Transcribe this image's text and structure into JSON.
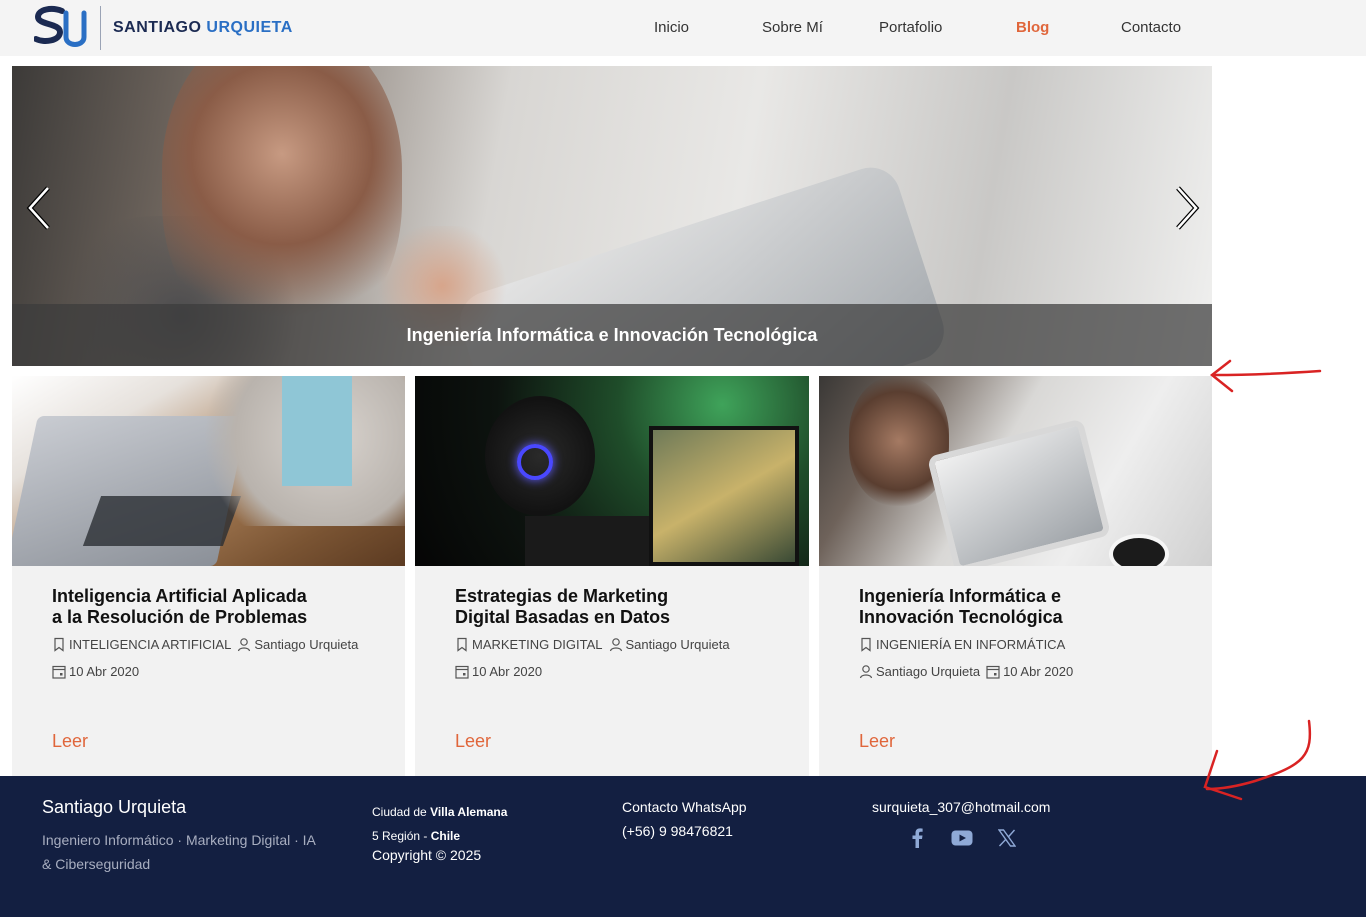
{
  "brand": {
    "logo_letters": "SU",
    "name_first": "SANTIAGO",
    "name_last": "URQUIETA",
    "accent_color": "#2a6fc4"
  },
  "nav": {
    "items": [
      {
        "label": "Inicio",
        "active": false
      },
      {
        "label": "Sobre Mí",
        "active": false
      },
      {
        "label": "Portafolio",
        "active": false
      },
      {
        "label": "Blog",
        "active": true
      },
      {
        "label": "Contacto",
        "active": false
      }
    ],
    "active_color": "#e0663b"
  },
  "hero": {
    "caption": "Ingeniería Informática e Innovación Tecnológica",
    "prev_icon": "chevron-left-icon",
    "next_icon": "chevron-right-icon"
  },
  "posts": [
    {
      "title_line1": "Inteligencia Artificial Aplicada",
      "title_line2": "a la Resolución de Problemas",
      "category": "INTELIGENCIA ARTIFICIAL",
      "author": "Santiago Urquieta",
      "date": "10 Abr 2020",
      "read_label": "Leer"
    },
    {
      "title_line1": "Estrategias de Marketing",
      "title_line2": "Digital Basadas en Datos",
      "category": "MARKETING DIGITAL",
      "author": "Santiago Urquieta",
      "date": "10 Abr 2020",
      "read_label": "Leer"
    },
    {
      "title_line1": "Ingeniería Informática e",
      "title_line2": "Innovación Tecnológica",
      "category": "INGENIERÍA EN INFORMÁTICA",
      "author": "Santiago Urquieta",
      "date": "10 Abr 2020",
      "read_label": "Leer"
    }
  ],
  "footer": {
    "name": "Santiago Urquieta",
    "tagline": "Ingeniero Informático · Marketing Digital · IA & Ciberseguridad",
    "city_prefix": "Ciudad de",
    "city": "Villa Alemana",
    "region_prefix": "5 Región -",
    "country": "Chile",
    "copyright": "Copyright © 2025",
    "whatsapp_label": "Contacto WhatsApp",
    "whatsapp_number": "(+56) 9 98476821",
    "email": "surquieta_307@hotmail.com",
    "social": [
      "facebook-icon",
      "youtube-icon",
      "x-twitter-icon"
    ],
    "background": "#131f41"
  }
}
